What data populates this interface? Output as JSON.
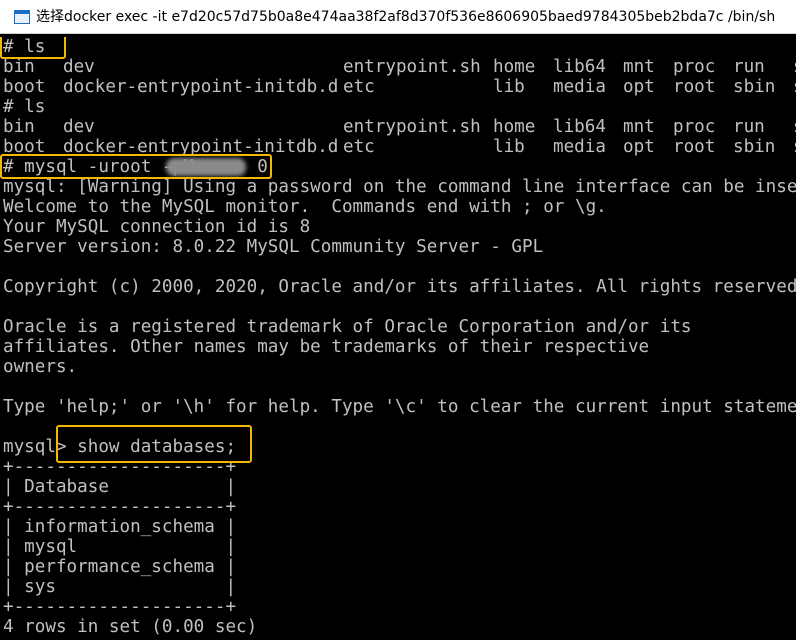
{
  "window": {
    "title": "选择docker  exec -it e7d20c57d75b0a8e474aa38f2af8d370f536e8606905baed9784305beb2bda7c /bin/sh",
    "icon": "console-window-icon"
  },
  "terminal": {
    "cmd1": "# ls",
    "ls_rows_1": [
      [
        "bin",
        "dev",
        "entrypoint.sh",
        "home",
        "lib64",
        "mnt",
        "proc",
        "run",
        "s"
      ],
      [
        "boot",
        "docker-entrypoint-initdb.d",
        "etc",
        "lib",
        "media",
        "opt",
        "root",
        "sbin",
        "s"
      ]
    ],
    "cmd2": "# ls",
    "ls_rows_2": [
      [
        "bin",
        "dev",
        "entrypoint.sh",
        "home",
        "lib64",
        "mnt",
        "proc",
        "run",
        "s"
      ],
      [
        "boot",
        "docker-entrypoint-initdb.d",
        "etc",
        "lib",
        "media",
        "opt",
        "root",
        "sbin",
        "s"
      ]
    ],
    "mysql_login": "# mysql -uroot -pM      0",
    "warning": "mysql: [Warning] Using a password on the command line interface can be insecure.",
    "welcome": "Welcome to the MySQL monitor.  Commands end with ; or \\g.",
    "connection": "Your MySQL connection id is 8",
    "server_version": "Server version: 8.0.22 MySQL Community Server - GPL",
    "copyright": "Copyright (c) 2000, 2020, Oracle and/or its affiliates. All rights reserved.",
    "trademark_1": "Oracle is a registered trademark of Oracle Corporation and/or its",
    "trademark_2": "affiliates. Other names may be trademarks of their respective",
    "trademark_3": "owners.",
    "help": "Type 'help;' or '\\h' for help. Type '\\c' to clear the current input statement.",
    "prompt": "mysql> show databases;",
    "table_border": "+--------------------+",
    "table_header": "| Database           |",
    "table_rows": [
      "| information_schema |",
      "| mysql              |",
      "| performance_schema |",
      "| sys                |"
    ],
    "result": "4 rows in set (0.00 sec)"
  },
  "colors": {
    "terminal_bg": "#000000",
    "terminal_fg": "#c0c0c0",
    "highlight": "#f5b800"
  }
}
